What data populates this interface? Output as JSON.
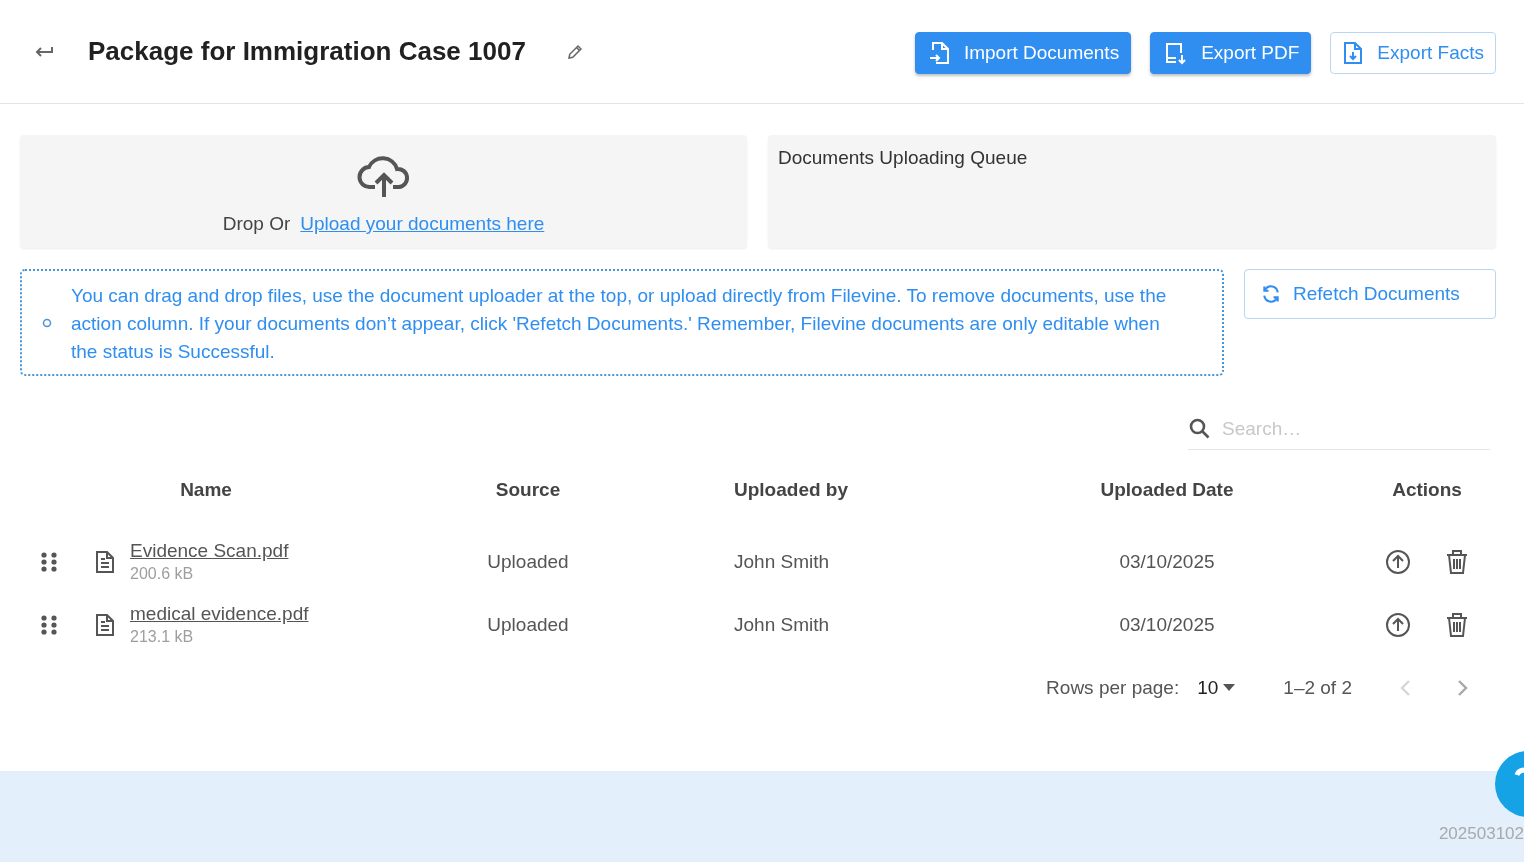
{
  "header": {
    "title": "Package for Immigration Case 1007",
    "buttons": [
      {
        "label": "Import Documents",
        "kind": "filled"
      },
      {
        "label": "Export PDF",
        "kind": "filled"
      },
      {
        "label": "Export Facts",
        "kind": "outlined"
      }
    ]
  },
  "upload": {
    "prompt": "Drop Or",
    "link": "Upload your documents here"
  },
  "queue": {
    "title": "Documents Uploading Queue"
  },
  "notice": {
    "text": "You can drag and drop files, use the document uploader at the top, or upload directly from Filevine. To remove documents, use the action column. If your documents don’t appear, click 'Refetch Documents.' Remember, Filevine documents are only editable when the status is Successful."
  },
  "refetch_button": {
    "label": "Refetch Documents"
  },
  "search": {
    "placeholder": "Search…"
  },
  "table": {
    "columns": [
      "Name",
      "Source",
      "Uploaded by",
      "Uploaded Date",
      "Actions"
    ],
    "rows": [
      {
        "name": "Evidence Scan.pdf",
        "size": "200.6 kB",
        "source": "Uploaded",
        "uploaded_by": "John Smith",
        "date": "03/10/2025"
      },
      {
        "name": "medical evidence.pdf",
        "size": "213.1 kB",
        "source": "Uploaded",
        "uploaded_by": "John Smith",
        "date": "03/10/2025"
      }
    ]
  },
  "pagination": {
    "rows_per_page_label": "Rows per page:",
    "rows_per_page": "10",
    "range": "1–2 of 2",
    "previous": {
      "disabled": true
    },
    "next": {
      "disabled": false
    }
  },
  "footer": {
    "version": "202503102"
  }
}
